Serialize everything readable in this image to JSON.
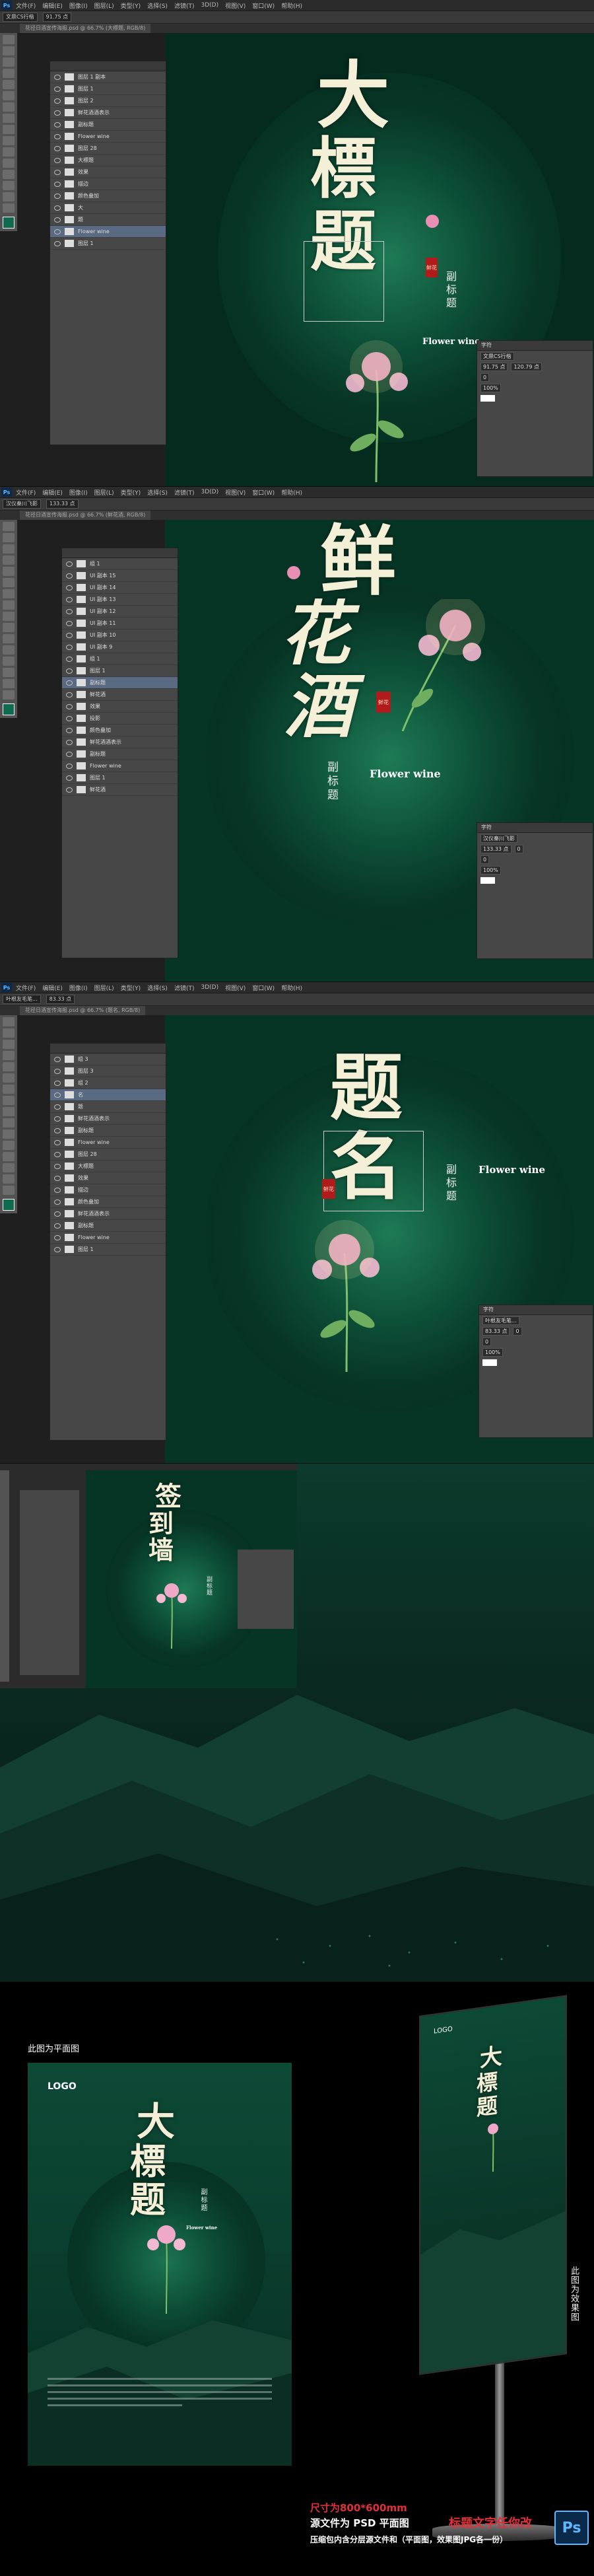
{
  "ps_menu": [
    "Ps",
    "文件(F)",
    "编辑(E)",
    "图像(I)",
    "图层(L)",
    "类型(Y)",
    "选择(S)",
    "滤镜(T)",
    "3D(D)",
    "视图(V)",
    "窗口(W)",
    "帮助(H)"
  ],
  "shot1": {
    "tab": "花径日酒宣传海报.psd @ 66.7% (大標题, RGB/8)",
    "font_field": "文鼎CS行楷",
    "size_field": "91.75 点",
    "title": [
      "大",
      "標",
      "题"
    ],
    "subtitle": "副标题",
    "seal": "鲜花",
    "english": "Flower wine",
    "layers": [
      "图层 1 副本",
      "图层 1",
      "图层 2",
      "鲜花酒酒表示",
      "副标题",
      "Flower wine",
      "图层 28",
      "大標题",
      "效果",
      "描边",
      "颜色叠加",
      "大",
      "題",
      "Flower wine",
      "图层 1"
    ],
    "char_panel": {
      "title": "字符",
      "font": "文鼎CS行楷",
      "size": "91.75 点",
      "leading": "120.79 点",
      "tracking": "0",
      "scale": "100%"
    }
  },
  "shot2": {
    "tab": "花径日酒宣传海报.psd @ 66.7% (鲜花酒, RGB/8)",
    "font_field": "汉仪秦川飞影",
    "size_field": "133.33 点",
    "title": [
      "鲜",
      "花",
      "酒"
    ],
    "subtitle": "副标题",
    "seal": "鲜花",
    "english": "Flower wine",
    "layers": [
      "组 1",
      "UI 副本 15",
      "UI 副本 14",
      "UI 副本 13",
      "UI 副本 12",
      "UI 副本 11",
      "UI 副本 10",
      "UI 副本 9",
      "组 1",
      "图层 1",
      "副标题",
      "鲜花酒",
      "效果",
      "投影",
      "颜色叠加",
      "鲜花酒酒表示",
      "副标题",
      "Flower wine",
      "图层 1",
      "鲜花酒"
    ],
    "char_panel": {
      "title": "字符",
      "font": "汉仪秦川飞影",
      "size": "133.33 点",
      "leading": "0",
      "tracking": "0",
      "scale": "100%"
    }
  },
  "shot3": {
    "tab": "花径日酒宣传海报.psd @ 66.7% (题名, RGB/8)",
    "font_field": "叶根友毛笔...",
    "size_field": "83.33 点",
    "title": [
      "题",
      "名"
    ],
    "subtitle": "副标题",
    "seal": "鲜花",
    "english": "Flower wine",
    "layers": [
      "组 3",
      "图层 3",
      "组 2",
      "名",
      "题",
      "鲜花酒酒表示",
      "副标题",
      "Flower wine",
      "图层 28",
      "大標题",
      "效果",
      "描边",
      "颜色叠加",
      "鲜花酒酒表示",
      "副标题",
      "Flower wine",
      "图层 1"
    ],
    "char_panel": {
      "title": "字符",
      "font": "叶根友毛笔...",
      "size": "83.33 点",
      "leading": "0",
      "tracking": "0",
      "scale": "100%"
    }
  },
  "shot4": {
    "title": [
      "签",
      "到",
      "墙"
    ],
    "subtitle": "副标题"
  },
  "preview": {
    "flat_label": "此图为平面图",
    "effect_label": "此图为效果图",
    "logo": "LOGO",
    "title": [
      "大",
      "標",
      "题"
    ],
    "subtitle": "副标题",
    "english": "Flower wine",
    "size_line": "尺寸为800*600mm",
    "source_line": "源文件为 PSD 平面图",
    "editable_line": "标题文字任你改",
    "package_line": "压缩包内含分层源文件和（平面图，效果图JPG各一份）",
    "ps_badge": "Ps"
  },
  "colors": {
    "ps_bg": "#2b2b2b",
    "poster_green": "#0d4f38",
    "title_cream": "#f4f0d8",
    "pink": "#f0a8c8",
    "seal_red": "#b21b1b",
    "spec_red": "#e0303a"
  }
}
